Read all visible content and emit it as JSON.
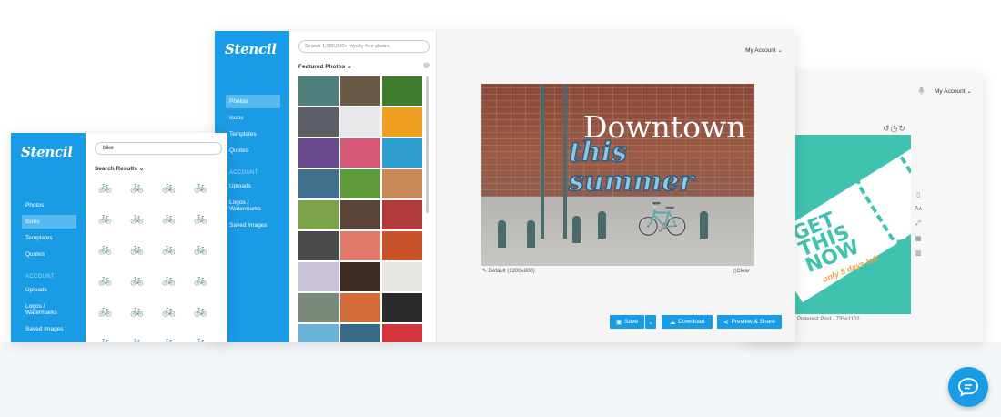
{
  "brand": {
    "logo": "Stencil",
    "accent": "#1a9be6"
  },
  "panel_left": {
    "search_value": "bike",
    "results_label": "Search Results",
    "nav": {
      "photos": "Photos",
      "icons": "Icons",
      "templates": "Templates",
      "quotes": "Quotes",
      "section": "ACCOUNT",
      "uploads": "Uploads",
      "logos": "Logos / Watermarks",
      "saved": "Saved Images"
    },
    "icon_glyph": "🚲"
  },
  "panel_middle": {
    "search_placeholder": "Search 1,080,000+ royalty-free photos",
    "featured_label": "Featured Photos",
    "help": "?",
    "nav": {
      "photos": "Photos",
      "icons": "Icons",
      "templates": "Templates",
      "quotes": "Quotes",
      "section": "ACCOUNT",
      "uploads": "Uploads",
      "logos": "Logos / Watermarks",
      "saved": "Saved Images"
    },
    "account": "My Account",
    "canvas": {
      "headline": "Downtown",
      "subline": "this summer"
    },
    "size_label": "Default (1200x800)",
    "clear_label": "Clear",
    "buttons": {
      "save": "Save",
      "download": "Download",
      "share": "Preview & Share"
    },
    "photo_colors": [
      "#4f7f7a",
      "#6a5a48",
      "#3f7a2d",
      "#5c5f66",
      "#e9e6ea",
      "#f0a020",
      "#6a4a8e",
      "#d75a7a",
      "#2f9fd0",
      "#3f6f8a",
      "#5f9a3a",
      "#c98a5a",
      "#7aa34a",
      "#5a4438",
      "#b23a3a",
      "#4a4a4a",
      "#e07a6a",
      "#c8522a",
      "#c9c2d8",
      "#3d2a20",
      "#e8e6e2",
      "#7a8a7a",
      "#d56a3a",
      "#2a2a2a",
      "#6ab3d6",
      "#3a6a8a",
      "#d4343c"
    ]
  },
  "panel_right": {
    "account": "My Account",
    "canvas": {
      "line1": "GET",
      "line2": "THIS",
      "line3": "NOW",
      "tagline": "only 5 days left"
    },
    "caption": "Pinterest Post - 735x1102"
  }
}
